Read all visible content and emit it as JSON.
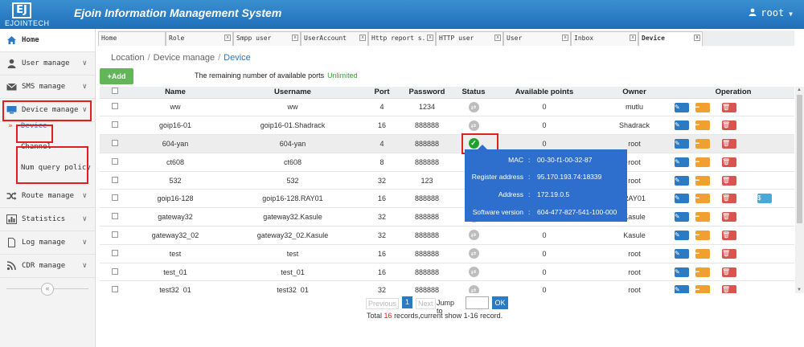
{
  "app": {
    "logo_mark": "EJ",
    "logo_text": "EJOINTECH",
    "title": "Ejoin Information Management System",
    "user": "root"
  },
  "sidebar": {
    "items": [
      {
        "label": "Home",
        "icon": "home-icon",
        "active": true
      },
      {
        "label": "User manage",
        "icon": "user-icon"
      },
      {
        "label": "SMS manage",
        "icon": "envelope-icon"
      },
      {
        "label": "Device manage",
        "icon": "monitor-icon",
        "expanded": true
      },
      {
        "label": "Route manage",
        "icon": "shuffle-icon"
      },
      {
        "label": "Statistics",
        "icon": "bar-chart-icon"
      },
      {
        "label": "Log manage",
        "icon": "file-icon"
      },
      {
        "label": "CDR manage",
        "icon": "rss-icon"
      }
    ],
    "sub_items": [
      {
        "label": "Device",
        "active": true
      },
      {
        "label": "Channel"
      },
      {
        "label": "Num query policy"
      }
    ],
    "collapse_label": "«"
  },
  "tabs": [
    {
      "label": "Home"
    },
    {
      "label": "Role"
    },
    {
      "label": "Smpp user"
    },
    {
      "label": "UserAccount"
    },
    {
      "label": "Http report s.."
    },
    {
      "label": "HTTP user"
    },
    {
      "label": "User"
    },
    {
      "label": "Inbox"
    },
    {
      "label": "Device",
      "active": true
    }
  ],
  "breadcrumb": {
    "items": [
      "Location",
      "Device manage",
      "Device"
    ],
    "separator": "/"
  },
  "toolbar": {
    "add_label": "Add",
    "remaining_label": "The remaining number of available ports",
    "remaining_value": "Unlimited"
  },
  "table": {
    "columns": [
      "Name",
      "Username",
      "Port",
      "Password",
      "Status",
      "Available points",
      "Owner",
      "Operation"
    ],
    "rows": [
      {
        "name": "ww",
        "username": "ww",
        "port": "4",
        "password": "1234",
        "status": "offline",
        "points": "0",
        "owner": "mutlu"
      },
      {
        "name": "goip16-01",
        "username": "goip16-01.Shadrack",
        "port": "16",
        "password": "888888",
        "status": "offline",
        "points": "0",
        "owner": "Shadrack"
      },
      {
        "name": "604-yan",
        "username": "604-yan",
        "port": "4",
        "password": "888888",
        "status": "online",
        "points": "0",
        "owner": "root",
        "selected": true
      },
      {
        "name": "ct608",
        "username": "ct608",
        "port": "8",
        "password": "888888",
        "status": "offline",
        "points": "0",
        "owner": "root"
      },
      {
        "name": "532",
        "username": "532",
        "port": "32",
        "password": "123",
        "status": "offline",
        "points": "0",
        "owner": "root"
      },
      {
        "name": "goip16-128",
        "username": "goip16-128.RAY01",
        "port": "16",
        "password": "888888",
        "status": "offline",
        "points": "0",
        "owner": "RAY01",
        "money": true
      },
      {
        "name": "gateway32",
        "username": "gateway32.Kasule",
        "port": "32",
        "password": "888888",
        "status": "offline",
        "points": "0",
        "owner": "Kasule"
      },
      {
        "name": "gateway32_02",
        "username": "gateway32_02.Kasule",
        "port": "32",
        "password": "888888",
        "status": "offline",
        "points": "0",
        "owner": "Kasule"
      },
      {
        "name": "test",
        "username": "test",
        "port": "16",
        "password": "888888",
        "status": "offline",
        "points": "0",
        "owner": "root"
      },
      {
        "name": "test_01",
        "username": "test_01",
        "port": "16",
        "password": "888888",
        "status": "offline",
        "points": "0",
        "owner": "root"
      },
      {
        "name": "test32_01",
        "username": "test32_01",
        "port": "32",
        "password": "888888",
        "status": "offline",
        "points": "0",
        "owner": "root"
      }
    ]
  },
  "tooltip": {
    "rows": [
      {
        "label": "MAC",
        "value": "00-30-f1-00-32-87"
      },
      {
        "label": "Register address",
        "value": "95.170.193.74:18339"
      },
      {
        "label": "Address",
        "value": "172.19.0.5"
      },
      {
        "label": "Software version",
        "value": "604-477-827-541-100-000"
      }
    ]
  },
  "pager": {
    "previous": "Previous",
    "page": "1",
    "next": "Next",
    "jump_label": "Jump to",
    "ok": "OK",
    "total_prefix": "Total",
    "total_count": "16",
    "total_suffix": "records,current show 1-16 record."
  },
  "colors": {
    "header": "#2a7bc3",
    "accent": "#2a7bc3",
    "highlight": "#e02020",
    "online": "#1fa12c"
  }
}
